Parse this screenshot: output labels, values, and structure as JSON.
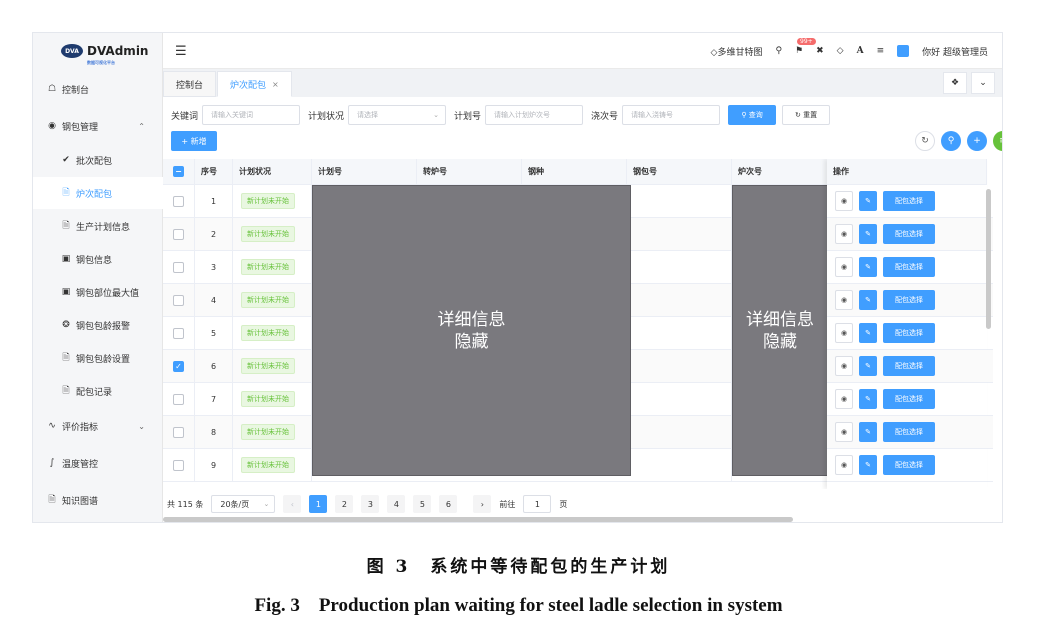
{
  "logo": {
    "mark": "DVA",
    "title": "DVAdmin",
    "subtitle": "数据可视化平台"
  },
  "sidebar": {
    "items": [
      {
        "label": "控制台",
        "icon": "home-icon"
      },
      {
        "label": "钢包管理",
        "icon": "circle-icon",
        "expanded": true
      },
      {
        "label": "批次配包",
        "icon": "check-icon"
      },
      {
        "label": "炉次配包",
        "icon": "document-icon",
        "active": true
      },
      {
        "label": "生产计划信息",
        "icon": "document-icon"
      },
      {
        "label": "钢包信息",
        "icon": "box-icon"
      },
      {
        "label": "钢包部位最大值",
        "icon": "box-icon"
      },
      {
        "label": "钢包包龄报警",
        "icon": "alert-icon"
      },
      {
        "label": "钢包包龄设置",
        "icon": "document-icon"
      },
      {
        "label": "配包记录",
        "icon": "document-icon"
      },
      {
        "label": "评价指标",
        "icon": "chart-icon"
      },
      {
        "label": "温度管控",
        "icon": "thermometer-icon"
      },
      {
        "label": "知识图谱",
        "icon": "document-icon"
      }
    ]
  },
  "header": {
    "gantt_label": "多维甘特图",
    "badge": "99+",
    "user_label": "你好 超级管理员",
    "font_icon_text": "A"
  },
  "tabs": [
    {
      "label": "控制台"
    },
    {
      "label": "炉次配包",
      "active": true
    }
  ],
  "search": {
    "keyword_label": "关键词",
    "keyword_placeholder": "请输入关键词",
    "status_label": "计划状况",
    "status_placeholder": "请选择",
    "plan_label": "计划号",
    "plan_placeholder": "请输入计划炉次号",
    "cast_label": "浇次号",
    "cast_placeholder": "请输入浇铸号",
    "query_label": "查询",
    "reset_label": "重置",
    "add_label": "+ 新增"
  },
  "table": {
    "columns": [
      "序号",
      "计划状况",
      "计划号",
      "转炉号",
      "钢种",
      "钢包号",
      "炉次号",
      "操作"
    ],
    "rows": [
      {
        "index": "1",
        "status": "新计划未开始",
        "checked": false
      },
      {
        "index": "2",
        "status": "新计划未开始",
        "checked": false
      },
      {
        "index": "3",
        "status": "新计划未开始",
        "checked": false
      },
      {
        "index": "4",
        "status": "新计划未开始",
        "checked": false
      },
      {
        "index": "5",
        "status": "新计划未开始",
        "checked": false
      },
      {
        "index": "6",
        "status": "新计划未开始",
        "checked": true
      },
      {
        "index": "7",
        "status": "新计划未开始",
        "checked": false
      },
      {
        "index": "8",
        "status": "新计划未开始",
        "checked": false
      },
      {
        "index": "9",
        "status": "新计划未开始",
        "checked": false
      }
    ],
    "mask_text_line1": "详细信息",
    "mask_text_line2": "隐藏",
    "select_button_label": "配包选择"
  },
  "pagination": {
    "total": "共 115 条",
    "page_size": "20条/页",
    "pages": [
      "1",
      "2",
      "3",
      "4",
      "5",
      "6"
    ],
    "current_page": "1",
    "goto_label": "前往",
    "goto_value": "1",
    "page_unit": "页"
  },
  "caption": {
    "cn": "图 3　系统中等待配包的生产计划",
    "en": "Fig. 3　Production plan waiting for steel ladle selection in system"
  },
  "colors": {
    "primary": "#409eff",
    "status_green": "#67c23a",
    "mask": "#7a797e"
  }
}
